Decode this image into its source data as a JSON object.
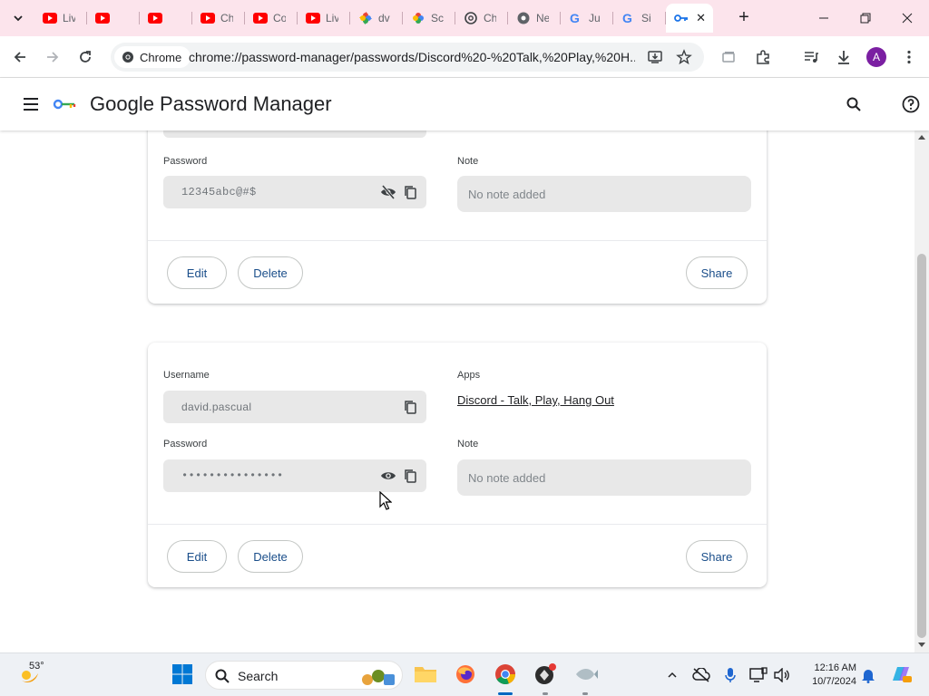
{
  "browser": {
    "tabs": [
      {
        "label": "Liv",
        "icon": "youtube-icon"
      },
      {
        "label": "",
        "icon": "youtube-icon"
      },
      {
        "label": "",
        "icon": "youtube-icon"
      },
      {
        "label": "Ch",
        "icon": "youtube-icon"
      },
      {
        "label": "Co",
        "icon": "youtube-icon"
      },
      {
        "label": "Liv",
        "icon": "youtube-icon"
      },
      {
        "label": "dv",
        "icon": "pinwheel-icon"
      },
      {
        "label": "Sc",
        "icon": "pinwheel-icon"
      },
      {
        "label": "Ch",
        "icon": "openai-icon"
      },
      {
        "label": "Ne",
        "icon": "globe-icon"
      },
      {
        "label": "Ju",
        "icon": "google-icon"
      },
      {
        "label": "Si",
        "icon": "google-icon"
      }
    ],
    "active_tab_icon": "key-icon",
    "chip_label": "Chrome",
    "url": "chrome://password-manager/passwords/Discord%20-%20Talk,%20Play,%20H...",
    "profile_initial": "A"
  },
  "app": {
    "title": "Google Password Manager"
  },
  "card1": {
    "password_label": "Password",
    "password_value": "12345abc@#$",
    "note_label": "Note",
    "note_value": "No note added",
    "edit": "Edit",
    "delete": "Delete",
    "share": "Share"
  },
  "card2": {
    "username_label": "Username",
    "username_value": "david.pascual",
    "apps_label": "Apps",
    "app_link": "Discord - Talk, Play, Hang Out",
    "password_label": "Password",
    "password_value": "•••••••••••••••",
    "note_label": "Note",
    "note_value": "No note added",
    "edit": "Edit",
    "delete": "Delete",
    "share": "Share"
  },
  "taskbar": {
    "temperature": "53°",
    "search_label": "Search",
    "time": "12:16 AM",
    "date": "10/7/2024"
  },
  "colors": {
    "tabstrip": "#fce4ec",
    "accent_text": "#1a4e8a",
    "field_bg": "#e8e8e8"
  }
}
